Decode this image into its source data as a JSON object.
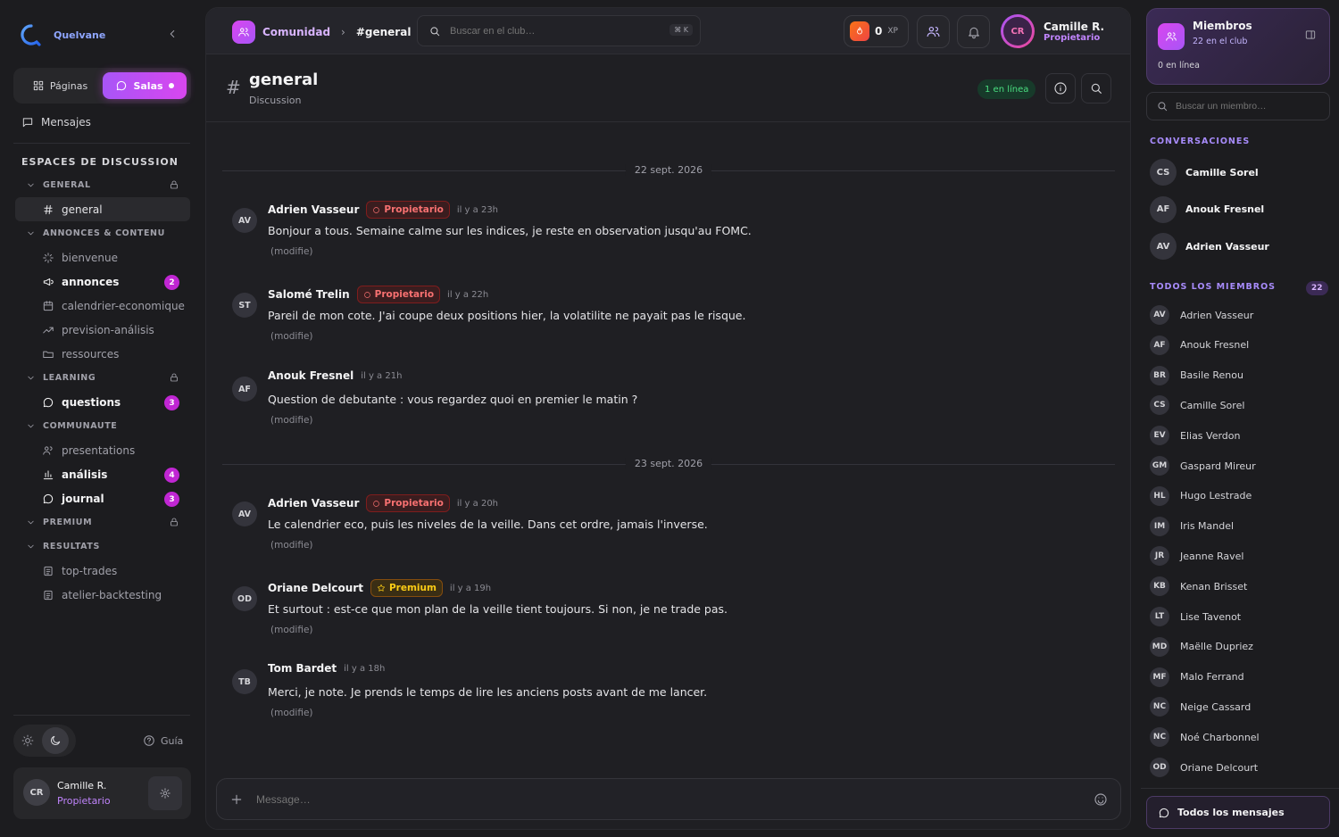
{
  "brand": {
    "name": "Quelvane"
  },
  "sidebar": {
    "seg_pages": "Páginas",
    "seg_rooms": "Salas",
    "messages": "Mensajes",
    "spaces_title": "ESPACES DE DISCUSSION",
    "categories": [
      {
        "label": "GENERAL",
        "locked": true,
        "channels": [
          {
            "label": "general",
            "icon": "hash-icon",
            "active": true
          }
        ]
      },
      {
        "label": "ANNONCES & CONTENU",
        "locked": false,
        "channels": [
          {
            "label": "bienvenue",
            "icon": "sparkles-icon"
          },
          {
            "label": "annonces",
            "icon": "megaphone-icon",
            "badge": "2",
            "bold": true
          },
          {
            "label": "calendrier-economique",
            "icon": "calendar-icon"
          },
          {
            "label": "prevision-análisis",
            "icon": "trending-icon"
          },
          {
            "label": "ressources",
            "icon": "folder-icon"
          }
        ]
      },
      {
        "label": "LEARNING",
        "locked": true,
        "channels": [
          {
            "label": "questions",
            "icon": "chat-icon",
            "badge": "3",
            "bold": true
          }
        ]
      },
      {
        "label": "COMMUNAUTE",
        "locked": false,
        "channels": [
          {
            "label": "presentations",
            "icon": "users-icon"
          },
          {
            "label": "análisis",
            "icon": "chart-icon",
            "badge": "4",
            "bold": true
          },
          {
            "label": "journal",
            "icon": "chat-icon",
            "badge": "3",
            "bold": true
          }
        ]
      },
      {
        "label": "PREMIUM",
        "locked": true,
        "channels": []
      },
      {
        "label": "RESULTATS",
        "locked": false,
        "channels": [
          {
            "label": "top-trades",
            "icon": "list-icon"
          },
          {
            "label": "atelier-backtesting",
            "icon": "list-icon"
          }
        ]
      }
    ],
    "guide": "Guía",
    "user": {
      "initials": "CR",
      "name": "Camille R.",
      "role": "Propietario"
    }
  },
  "topbar": {
    "community": "Comunidad",
    "channel": "#general",
    "search_placeholder": "Buscar en el club…",
    "shortcut": "⌘ K",
    "xp_value": "0",
    "xp_label": "XP",
    "user_initials": "CR",
    "user_name": "Camille R.",
    "user_role": "Propietario"
  },
  "channel": {
    "name": "general",
    "description": "Discussion",
    "online": "1 en línea"
  },
  "messages": [
    {
      "type": "date",
      "label": "22 sept. 2026"
    },
    {
      "type": "msg",
      "initials": "AV",
      "author": "Adrien Vasseur",
      "role": "Propietario",
      "role_kind": "owner",
      "time": "il y a 23h",
      "body": "Bonjour a tous. Semaine calme sur les indices, je reste en observation jusqu'au FOMC.",
      "edited": "(modifie)"
    },
    {
      "type": "msg",
      "initials": "ST",
      "author": "Salomé Trelin",
      "role": "Propietario",
      "role_kind": "owner",
      "time": "il y a 22h",
      "body": "Pareil de mon cote. J'ai coupe deux positions hier, la volatilite ne payait pas le risque.",
      "edited": "(modifie)"
    },
    {
      "type": "msg",
      "initials": "AF",
      "author": "Anouk Fresnel",
      "role": "",
      "role_kind": "",
      "time": "il y a 21h",
      "body": "Question de debutante : vous regardez quoi en premier le matin ?",
      "edited": "(modifie)"
    },
    {
      "type": "date",
      "label": "23 sept. 2026"
    },
    {
      "type": "msg",
      "initials": "AV",
      "author": "Adrien Vasseur",
      "role": "Propietario",
      "role_kind": "owner",
      "time": "il y a 20h",
      "body": "Le calendrier eco, puis les niveles de la veille. Dans cet ordre, jamais l'inverse.",
      "edited": "(modifie)"
    },
    {
      "type": "msg",
      "initials": "OD",
      "author": "Oriane Delcourt",
      "role": "Premium",
      "role_kind": "prem",
      "time": "il y a 19h",
      "body": "Et surtout : est-ce que mon plan de la veille tient toujours. Si non, je ne trade pas.",
      "edited": "(modifie)"
    },
    {
      "type": "msg",
      "initials": "TB",
      "author": "Tom Bardet",
      "role": "",
      "role_kind": "",
      "time": "il y a 18h",
      "body": "Merci, je note. Je prends le temps de lire les anciens posts avant de me lancer.",
      "edited": "(modifie)"
    }
  ],
  "composer": {
    "placeholder": "Message…"
  },
  "members_panel": {
    "title": "Miembros",
    "subtitle": "22 en el club",
    "online": "0 en línea",
    "search_placeholder": "Buscar un miembro…",
    "conversations_title": "CONVERSACIONES",
    "conversations": [
      {
        "initials": "CS",
        "name": "Camille Sorel"
      },
      {
        "initials": "AF",
        "name": "Anouk Fresnel"
      },
      {
        "initials": "AV",
        "name": "Adrien Vasseur"
      }
    ],
    "all_title": "TODOS LOS MIEMBROS",
    "all_count": "22",
    "members": [
      {
        "initials": "AV",
        "name": "Adrien Vasseur"
      },
      {
        "initials": "AF",
        "name": "Anouk Fresnel"
      },
      {
        "initials": "BR",
        "name": "Basile Renou"
      },
      {
        "initials": "CS",
        "name": "Camille Sorel"
      },
      {
        "initials": "EV",
        "name": "Elias Verdon"
      },
      {
        "initials": "GM",
        "name": "Gaspard Mireur"
      },
      {
        "initials": "HL",
        "name": "Hugo Lestrade"
      },
      {
        "initials": "IM",
        "name": "Iris Mandel"
      },
      {
        "initials": "JR",
        "name": "Jeanne Ravel"
      },
      {
        "initials": "KB",
        "name": "Kenan Brisset"
      },
      {
        "initials": "LT",
        "name": "Lise Tavenot"
      },
      {
        "initials": "MD",
        "name": "Maëlle Dupriez"
      },
      {
        "initials": "MF",
        "name": "Malo Ferrand"
      },
      {
        "initials": "NC",
        "name": "Neige Cassard"
      },
      {
        "initials": "NC",
        "name": "Noé Charbonnel"
      },
      {
        "initials": "OD",
        "name": "Oriane Delcourt"
      }
    ],
    "all_messages": "Todos los mensajes"
  }
}
